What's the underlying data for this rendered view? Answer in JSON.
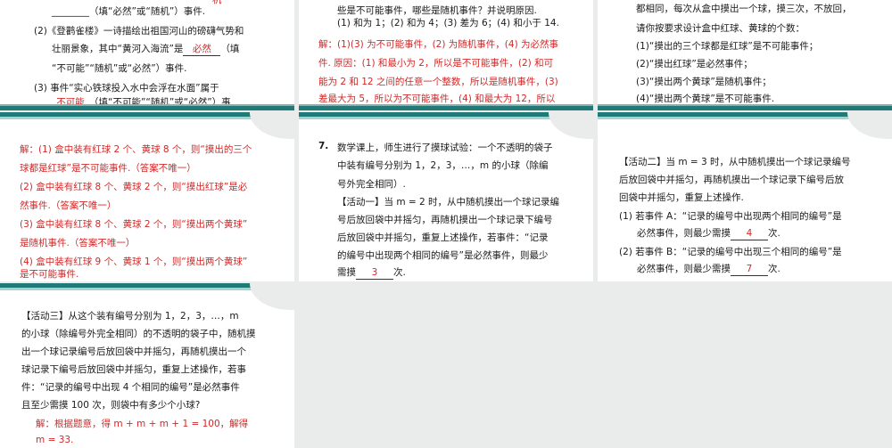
{
  "s1": {
    "l0a": "机",
    "l1": "________（填“必然”或“随机”）事件.",
    "l2": "(2)《登鹳雀楼》一诗描绘出祖国河山的磅礴气势和",
    "l3a": "壮丽景象，其中“黄河入海流”是",
    "l3b": "必然",
    "l3c": "（填",
    "l4": "“不可能”“随机”或“必然”）事件.",
    "l5": "(3) 事件“实心铁球投入水中会浮在水面”属于",
    "l6a": "不可能",
    "l6b": "（填“不可能”“随机”或“必然”）事"
  },
  "s2": {
    "l1": "些是不可能事件，哪些是随机事件？并说明原因.",
    "l2": "(1) 和为 1；(2) 和为 4；(3) 差为 6；(4) 和小于 14.",
    "l3": "解：(1)(3) 为不可能事件，(2) 为随机事件，(4) 为必然事",
    "l4": "件. 原因：(1) 和最小为 2，所以是不可能事件，(2) 和可",
    "l5": "能为 2 和 12 之间的任意一个整数，所以是随机事件，(3)",
    "l6": "差最大为 5，所以为不可能事件，(4) 和最大为 12，所以"
  },
  "s3": {
    "l1": "都相同，每次从盒中摸出一个球，摸三次，不放回，",
    "l2": "请你按要求设计盒中红球、黄球的个数：",
    "l3": "(1)“摸出的三个球都是红球”是不可能事件；",
    "l4": "(2)“摸出红球”是必然事件；",
    "l5": "(3)“摸出两个黄球”是随机事件；",
    "l6": "(4)“摸出两个黄球”是不可能事件."
  },
  "s4": {
    "l1": "解：(1) 盒中装有红球 2 个、黄球 8 个，则“摸出的三个",
    "l2": "球都是红球”是不可能事件.（答案不唯一）",
    "l3": "(2) 盒中装有红球 8 个、黄球 2 个，则“摸出红球”是必",
    "l4": "然事件.（答案不唯一）",
    "l5": "(3) 盒中装有红球 8 个、黄球 2 个，则“摸出两个黄球”",
    "l6": "是随机事件.（答案不唯一）",
    "l7": "(4) 盒中装有红球 9 个、黄球 1 个，则“摸出两个黄球”",
    "l8": "是不可能事件."
  },
  "s5": {
    "num": "7.",
    "l1": "数学课上，师生进行了摸球试验：一个不透明的袋子",
    "l2": "中装有编号分别为 1，2，3，…，m 的小球（除编",
    "l3": "号外完全相同）.",
    "l4": "【活动一】当 m = 2 时，从中随机摸出一个球记录编",
    "l5": "号后放回袋中并摇匀，再随机摸出一个球记录下编号",
    "l6": "后放回袋中并摇匀，重复上述操作，若事件：“记录",
    "l7": "的编号中出现两个相同的编号”是必然事件，则最少",
    "l8a": "需摸",
    "l8b": "3",
    "l8c": "次."
  },
  "s6": {
    "l1": "【活动二】当 m = 3 时，从中随机摸出一个球记录编号",
    "l2": "后放回袋中并摇匀，再随机摸出一个球记录下编号后放",
    "l3": "回袋中并摇匀，重复上述操作.",
    "l4": "(1) 若事件 A：“记录的编号中出现两个相同的编号”是",
    "l5a": "必然事件，则最少需摸",
    "l5b": "4",
    "l5c": "次.",
    "l6": "(2) 若事件 B：“记录的编号中出现三个相同的编号”是",
    "l7a": "必然事件，则最少需摸",
    "l7b": "7",
    "l7c": "次."
  },
  "s7": {
    "l1": "【活动三】从这个装有编号分别为 1，2，3，…，m",
    "l2": "的小球（除编号外完全相同）的不透明的袋子中，随机摸",
    "l3": "出一个球记录编号后放回袋中并摇匀，再随机摸出一个",
    "l4": "球记录下编号后放回袋中并摇匀，重复上述操作，若事",
    "l5": "件：“记录的编号中出现 4 个相同的编号”是必然事件",
    "l6": "且至少需摸 100 次，则袋中有多少个小球?",
    "l7": "解：根据题意，得 m + m + m + 1 = 100，解得",
    "l8": "m = 33."
  }
}
